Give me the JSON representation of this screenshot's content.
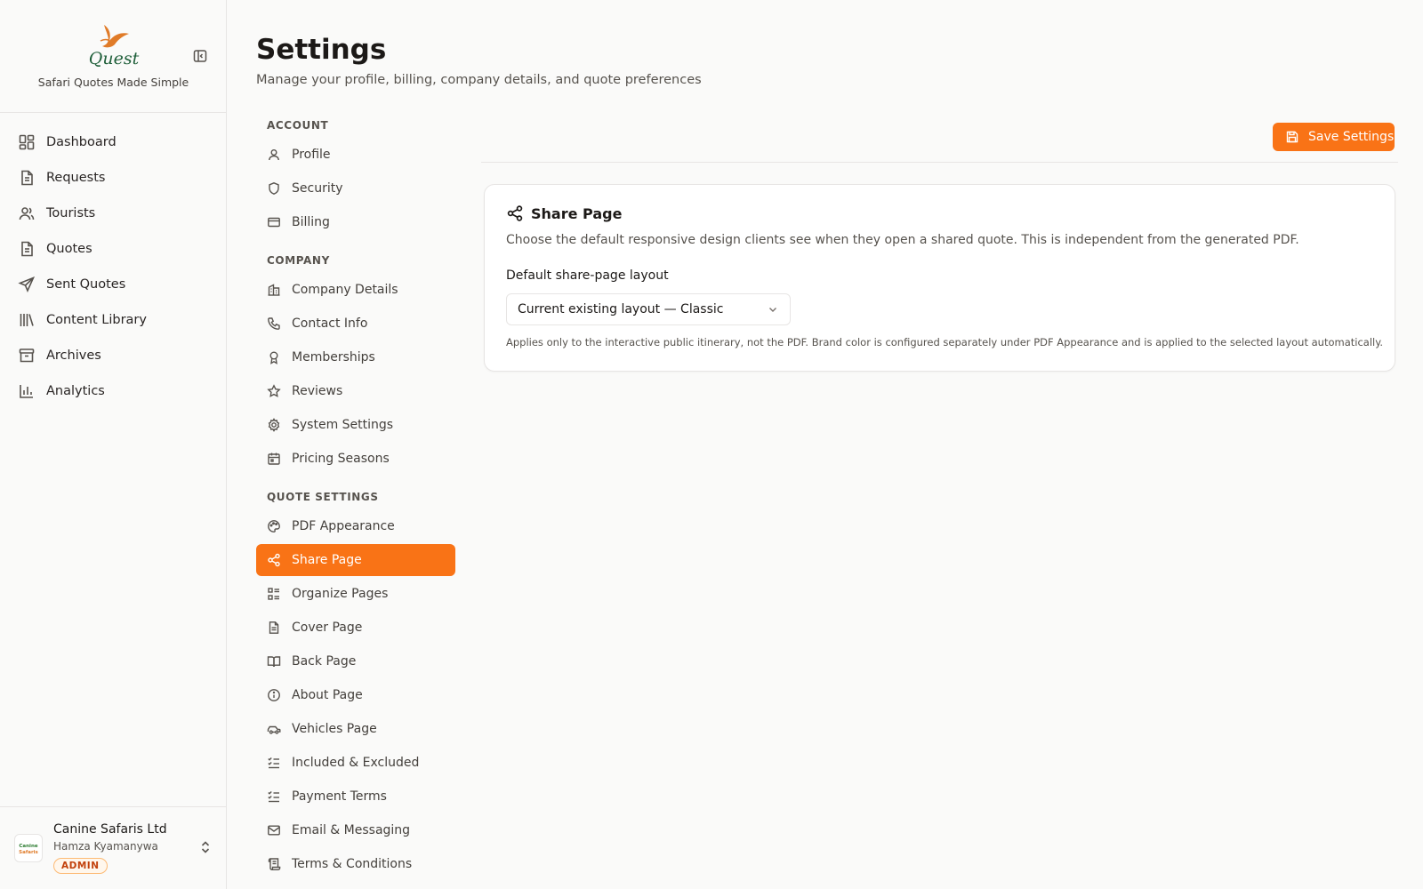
{
  "brand": {
    "logo_text": "Quest",
    "tagline": "Safari Quotes Made Simple"
  },
  "main_nav": [
    {
      "label": "Dashboard",
      "icon": "dashboard-icon"
    },
    {
      "label": "Requests",
      "icon": "document-icon"
    },
    {
      "label": "Tourists",
      "icon": "users-icon"
    },
    {
      "label": "Quotes",
      "icon": "document-icon"
    },
    {
      "label": "Sent Quotes",
      "icon": "send-icon"
    },
    {
      "label": "Content Library",
      "icon": "library-icon"
    },
    {
      "label": "Archives",
      "icon": "archive-icon"
    },
    {
      "label": "Analytics",
      "icon": "chart-icon"
    }
  ],
  "account": {
    "company": "Canine Safaris Ltd",
    "user": "Hamza Kyamanywa",
    "role": "ADMIN",
    "avatar_text": "Canine Safaris"
  },
  "page": {
    "title": "Settings",
    "subtitle": "Manage your profile, billing, company details, and quote preferences"
  },
  "settings_nav": {
    "account_heading": "ACCOUNT",
    "account_items": [
      "Profile",
      "Security",
      "Billing"
    ],
    "company_heading": "COMPANY",
    "company_items": [
      "Company Details",
      "Contact Info",
      "Memberships",
      "Reviews",
      "System Settings",
      "Pricing Seasons"
    ],
    "quote_heading": "QUOTE SETTINGS",
    "quote_items": [
      "PDF Appearance",
      "Share Page",
      "Organize Pages",
      "Cover Page",
      "Back Page",
      "About Page",
      "Vehicles Page",
      "Included & Excluded",
      "Payment Terms",
      "Email & Messaging",
      "Terms & Conditions"
    ],
    "active": "Share Page"
  },
  "toolbar": {
    "save_label": "Save Settings"
  },
  "share_card": {
    "title": "Share Page",
    "description": "Choose the default responsive design clients see when they open a shared quote. This is independent from the generated PDF.",
    "field_label": "Default share-page layout",
    "selected_value": "Current existing layout — Classic",
    "help": "Applies only to the interactive public itinerary, not the PDF. Brand color is configured separately under PDF Appearance and is applied to the selected layout automatically."
  },
  "colors": {
    "accent": "#f97316",
    "logo_green": "#1f5f3a",
    "logo_orange": "#e07b28"
  }
}
